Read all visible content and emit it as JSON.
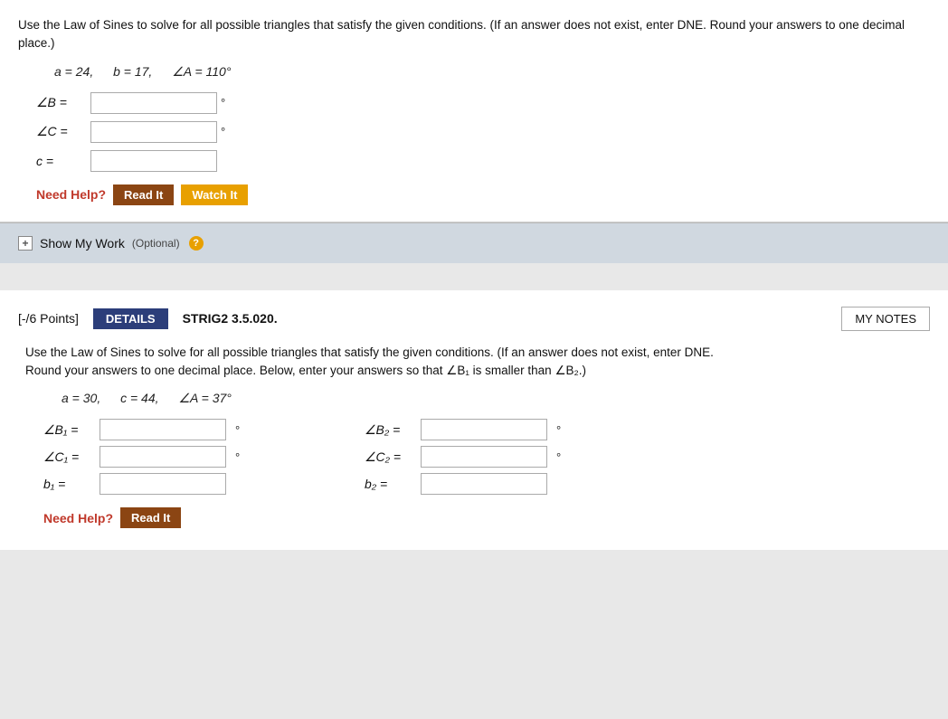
{
  "problem1": {
    "instructions": "Use the Law of Sines to solve for all possible triangles that satisfy the given conditions. (If an answer does not exist, enter DNE. Round your answers to one decimal place.)",
    "given": {
      "a": "a = 24,",
      "b": "b = 17,",
      "angleA": "∠A = 110°"
    },
    "fields": {
      "angleB_label": "∠B =",
      "angleC_label": "∠C =",
      "c_label": "c ="
    },
    "degree": "°",
    "needHelp": "Need Help?",
    "readIt": "Read It",
    "watchIt": "Watch It"
  },
  "showMyWork": {
    "icon": "+",
    "label": "Show My Work",
    "optional": "(Optional)",
    "question": "?"
  },
  "problem2": {
    "points": "[-/6 Points]",
    "details": "DETAILS",
    "code": "STRIG2 3.5.020.",
    "myNotes": "MY NOTES",
    "instructions_line1": "Use the Law of Sines to solve for all possible triangles that satisfy the given conditions. (If an answer does not exist, enter DNE.",
    "instructions_line2": "Round your answers to one decimal place. Below, enter your answers so that ∠B₁ is smaller than ∠B₂.)",
    "given": {
      "a": "a = 30,",
      "c": "c = 44,",
      "angleA": "∠A = 37°"
    },
    "fields": {
      "angleB1_label": "∠B₁ =",
      "angleB2_label": "∠B₂ =",
      "angleC1_label": "∠C₁ =",
      "angleC2_label": "∠C₂ =",
      "b1_label": "b₁ =",
      "b2_label": "b₂ ="
    },
    "degree": "°",
    "needHelp": "Need Help?",
    "readIt": "Read It"
  }
}
